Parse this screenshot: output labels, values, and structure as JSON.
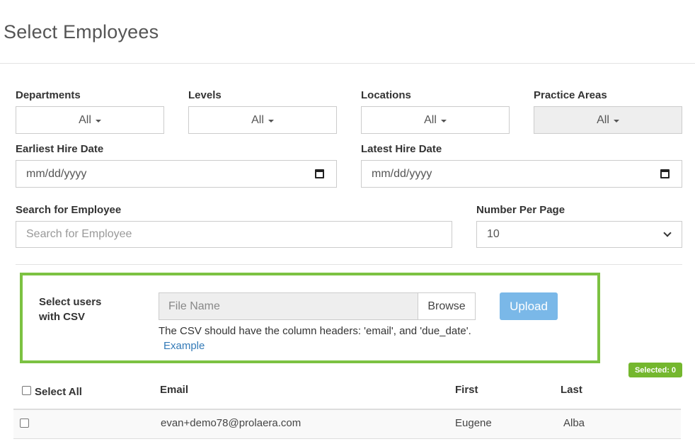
{
  "page": {
    "title": "Select Employees"
  },
  "filters": {
    "departments": {
      "label": "Departments",
      "value": "All"
    },
    "levels": {
      "label": "Levels",
      "value": "All"
    },
    "locations": {
      "label": "Locations",
      "value": "All"
    },
    "practice_areas": {
      "label": "Practice Areas",
      "value": "All"
    },
    "earliest_hire": {
      "label": "Earliest Hire Date",
      "value": "mm/dd/yyyy"
    },
    "latest_hire": {
      "label": "Latest Hire Date",
      "value": "mm/dd/yyyy"
    },
    "search": {
      "label": "Search for Employee",
      "placeholder": "Search for Employee"
    },
    "per_page": {
      "label": "Number Per Page",
      "value": "10"
    }
  },
  "csv": {
    "label": "Select users with CSV",
    "file_placeholder": "File Name",
    "browse_label": "Browse",
    "upload_label": "Upload",
    "help_text": "The CSV should have the column headers: 'email', and 'due_date'.",
    "example_link": "Example"
  },
  "selection": {
    "badge": "Selected: 0"
  },
  "table": {
    "headers": {
      "select_all": "Select All",
      "email": "Email",
      "first": "First",
      "last": "Last"
    },
    "rows": [
      {
        "email": "evan+demo78@prolaera.com",
        "first": "Eugene",
        "last": "Alba"
      }
    ]
  },
  "colors": {
    "accent_green": "#7cc242",
    "upload_blue": "#7ab8e8",
    "link_blue": "#337ab7"
  }
}
